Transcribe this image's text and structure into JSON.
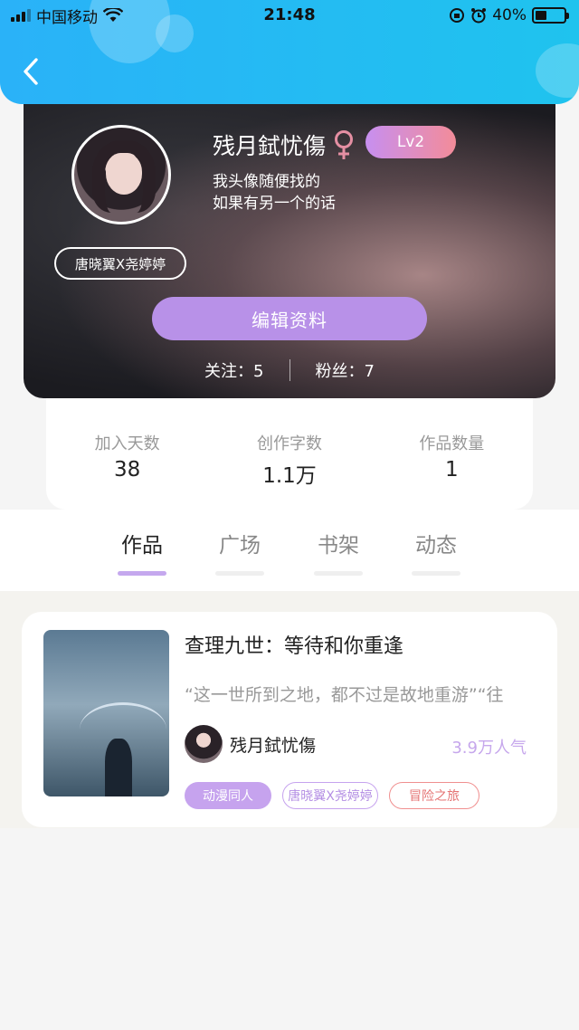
{
  "status_bar": {
    "carrier": "中国移动",
    "time": "21:48",
    "battery_text": "40%",
    "battery_level": 0.4
  },
  "header": {
    "back_icon": "chevron-left-icon",
    "accent_color": "#2ab2f8"
  },
  "profile": {
    "username": "残月鉽忧傷",
    "gender_icon": "female-icon",
    "level": "Lv2",
    "bio_line1": "我头像随便找的",
    "bio_line2": "如果有另一个的话",
    "cp_badge": "唐晓翼X尧婷婷",
    "edit_button": "编辑资料",
    "following_label": "关注：",
    "following_count": "5",
    "followers_label": "粉丝：",
    "followers_count": "7"
  },
  "stats": [
    {
      "label": "加入天数",
      "value": "38"
    },
    {
      "label": "创作字数",
      "value": "1.1万"
    },
    {
      "label": "作品数量",
      "value": "1"
    }
  ],
  "tabs": [
    {
      "label": "作品",
      "active": true
    },
    {
      "label": "广场",
      "active": false
    },
    {
      "label": "书架",
      "active": false
    },
    {
      "label": "动态",
      "active": false
    }
  ],
  "works": [
    {
      "title": "查理九世：等待和你重逢",
      "description": "“这一世所到之地，都不过是故地重游”“往",
      "author": "残月鉽忧傷",
      "popularity": "3.9万人气",
      "tags": [
        "动漫同人",
        "唐晓翼X尧婷婷",
        "冒险之旅"
      ]
    }
  ]
}
